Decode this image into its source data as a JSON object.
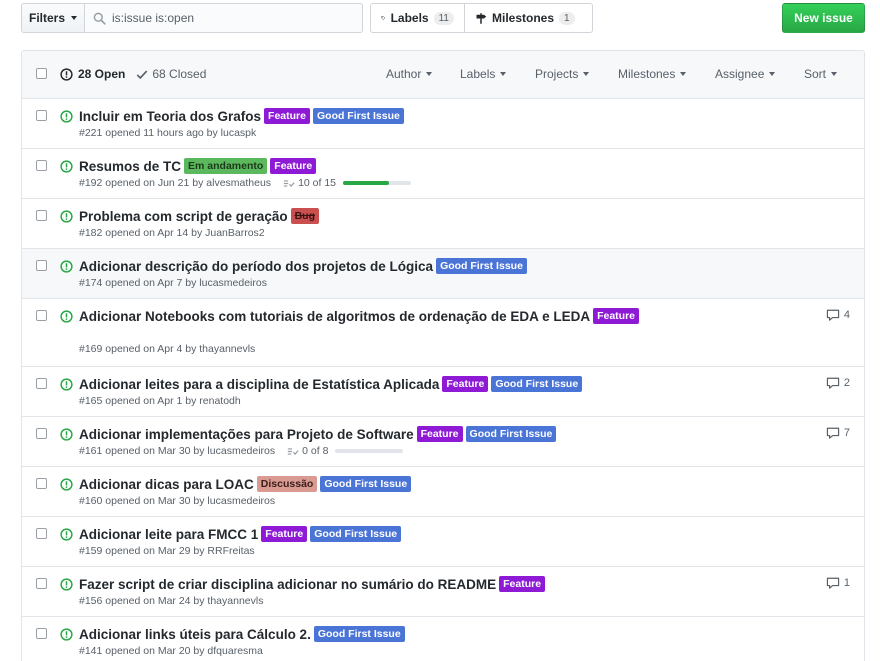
{
  "filters": {
    "label": "Filters",
    "query": "is:issue is:open"
  },
  "nav": {
    "labels": {
      "label": "Labels",
      "count": "11"
    },
    "milestones": {
      "label": "Milestones",
      "count": "1"
    }
  },
  "new_issue_label": "New issue",
  "header": {
    "open_label": "28 Open",
    "closed_label": "68 Closed",
    "menus": [
      "Author",
      "Labels",
      "Projects",
      "Milestones",
      "Assignee",
      "Sort"
    ]
  },
  "label_colors": {
    "Feature": {
      "bg": "#8e1ad6",
      "fg": "#ffffff"
    },
    "Good First Issue": {
      "bg": "#4a74d6",
      "fg": "#ffffff"
    },
    "Em andamento": {
      "bg": "#5cb85c",
      "fg": "#1b3a1b"
    },
    "Bug": {
      "bg": "#c9504e",
      "fg": "#3a1313"
    },
    "Discussão": {
      "bg": "#d99a92",
      "fg": "#3a1e1b"
    }
  },
  "colors": {
    "open_icon": "#28a745",
    "accent": "#28a745"
  },
  "issues": [
    {
      "title": "Incluir em Teoria dos Grafos",
      "labels": [
        "Feature",
        "Good First Issue"
      ],
      "meta": "#221 opened 11 hours ago by lucaspk",
      "comments": "",
      "progress": ""
    },
    {
      "title": "Resumos de TC",
      "labels": [
        "Em andamento",
        "Feature"
      ],
      "meta": "#192 opened on Jun 21 by alvesmatheus",
      "comments": "",
      "progress": "10 of 15",
      "progress_fraction": 0.6667
    },
    {
      "title": "Problema com script de geração",
      "labels": [
        "Bug"
      ],
      "meta": "#182 opened on Apr 14 by JuanBarros2",
      "comments": "",
      "progress": ""
    },
    {
      "title": "Adicionar descrição do período dos projetos de Lógica",
      "labels": [
        "Good First Issue"
      ],
      "meta": "#174 opened on Apr 7 by lucasmedeiros",
      "comments": "",
      "progress": "",
      "highlight": true
    },
    {
      "title": "Adicionar Notebooks com tutoriais de algoritmos de ordenação de EDA e LEDA",
      "labels": [
        "Feature"
      ],
      "meta": "#169 opened on Apr 4 by thayannevls",
      "comments": "4",
      "progress": "",
      "wrap": true
    },
    {
      "title": "Adicionar leites para a disciplina de Estatística Aplicada",
      "labels": [
        "Feature",
        "Good First Issue"
      ],
      "meta": "#165 opened on Apr 1 by renatodh",
      "comments": "2",
      "progress": ""
    },
    {
      "title": "Adicionar implementações para Projeto de Software",
      "labels": [
        "Feature",
        "Good First Issue"
      ],
      "meta": "#161 opened on Mar 30 by lucasmedeiros",
      "comments": "7",
      "progress": "0 of 8",
      "progress_fraction": 0
    },
    {
      "title": "Adicionar dicas para LOAC",
      "labels": [
        "Discussão",
        "Good First Issue"
      ],
      "meta": "#160 opened on Mar 30 by lucasmedeiros",
      "comments": "",
      "progress": ""
    },
    {
      "title": "Adicionar leite para FMCC 1",
      "labels": [
        "Feature",
        "Good First Issue"
      ],
      "meta": "#159 opened on Mar 29 by RRFreitas",
      "comments": "",
      "progress": ""
    },
    {
      "title": "Fazer script de criar disciplina adicionar no sumário do README",
      "labels": [
        "Feature"
      ],
      "meta": "#156 opened on Mar 24 by thayannevls",
      "comments": "1",
      "progress": ""
    },
    {
      "title": "Adicionar links úteis para Cálculo 2.",
      "labels": [
        "Good First Issue"
      ],
      "meta": "#141 opened on Mar 20 by dfquaresma",
      "comments": "",
      "progress": ""
    }
  ]
}
